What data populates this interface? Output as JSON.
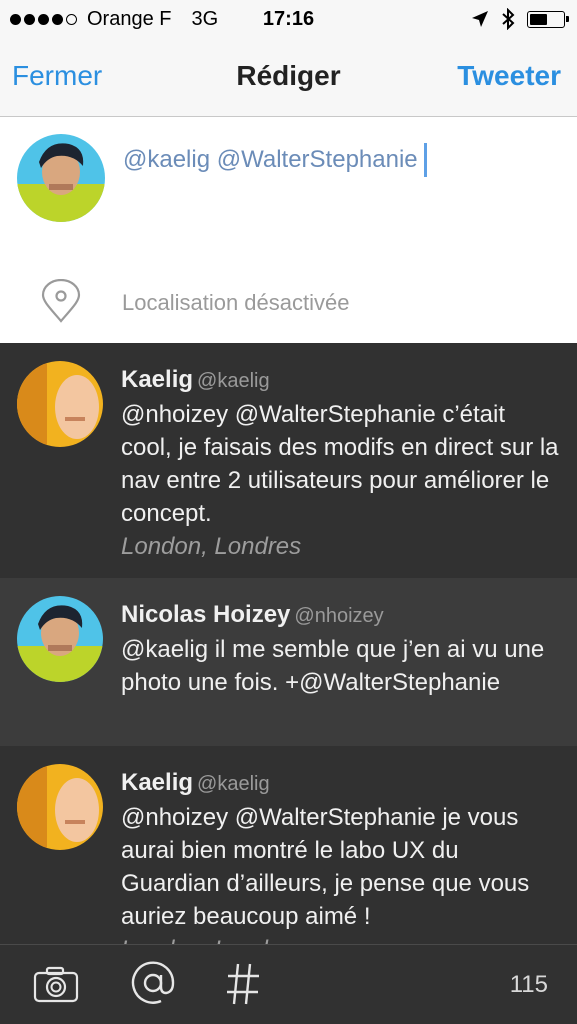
{
  "status_bar": {
    "carrier": "Orange F",
    "network": "3G",
    "time": "17:16",
    "signal_bars_filled": 4,
    "signal_bars_total": 5,
    "icons": [
      "location-arrow-icon",
      "bluetooth-icon",
      "battery-icon"
    ]
  },
  "nav": {
    "left_label": "Fermer",
    "title": "Rédiger",
    "right_label": "Tweeter",
    "accent_color": "#2b8fe0"
  },
  "compose": {
    "text": "@kaelig @WalterStephanie",
    "location": "Localisation désactivée"
  },
  "tweets": [
    {
      "name": "Kaelig",
      "handle": "@kaelig",
      "text": "@nhoizey @WalterStephanie c’était cool, je faisais des modifs en direct sur la nav entre 2 utilisateurs pour améliorer le concept.",
      "location": "London, Londres"
    },
    {
      "name": "Nicolas Hoizey",
      "handle": "@nhoizey",
      "text": "@kaelig il me semble que j’en ai vu une photo une fois. +@WalterStephanie",
      "location": ""
    },
    {
      "name": "Kaelig",
      "handle": "@kaelig",
      "text": "@nhoizey @WalterStephanie je vous aurai bien montré le labo UX du Guardian d’ailleurs, je pense que vous auriez beaucoup aimé !",
      "location": "London, Londres"
    }
  ],
  "toolbar": {
    "icons": [
      "camera-icon",
      "at-icon",
      "hashtag-icon"
    ],
    "char_count": "115"
  }
}
